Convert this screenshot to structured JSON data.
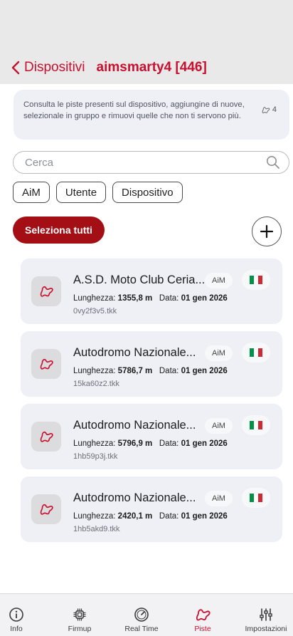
{
  "nav": {
    "back_label": "Dispositivi",
    "title": "aimsmarty4 [446]"
  },
  "info": {
    "text": "Consulta le piste presenti sul dispositivo, aggiungine di nuove, selezionale in gruppo e rimuovi quelle che non ti servono più.",
    "count": "4"
  },
  "search": {
    "placeholder": "Cerca"
  },
  "filters": [
    "AiM",
    "Utente",
    "Dispositivo"
  ],
  "select_all_label": "Seleziona tutti",
  "labels": {
    "length": "Lunghezza:",
    "date": "Data:"
  },
  "tracks": [
    {
      "name": "A.S.D. Moto Club Ceria...",
      "source": "AiM",
      "length": "1355,8 m",
      "date": "01 gen 2026",
      "file": "0vy2f3v5.tkk"
    },
    {
      "name": "Autodromo Nazionale...",
      "source": "AiM",
      "length": "5786,7 m",
      "date": "01 gen 2026",
      "file": "15ka60z2.tkk"
    },
    {
      "name": "Autodromo Nazionale...",
      "source": "AiM",
      "length": "5796,9 m",
      "date": "01 gen 2026",
      "file": "1hb59p3j.tkk"
    },
    {
      "name": "Autodromo Nazionale...",
      "source": "AiM",
      "length": "2420,1 m",
      "date": "01 gen 2026",
      "file": "1hb5akd9.tkk"
    }
  ],
  "tabs": [
    {
      "label": "Info",
      "icon": "info-icon"
    },
    {
      "label": "Firmup",
      "icon": "chip-icon"
    },
    {
      "label": "Real Time",
      "icon": "gauge-icon"
    },
    {
      "label": "Piste",
      "icon": "track-icon",
      "active": true
    },
    {
      "label": "Impostazioni",
      "icon": "sliders-icon"
    }
  ],
  "colors": {
    "accent": "#c8102e",
    "button": "#a30f14",
    "card": "#eef0f5",
    "flag": [
      "#009246",
      "#ffffff",
      "#ce2b37"
    ]
  }
}
